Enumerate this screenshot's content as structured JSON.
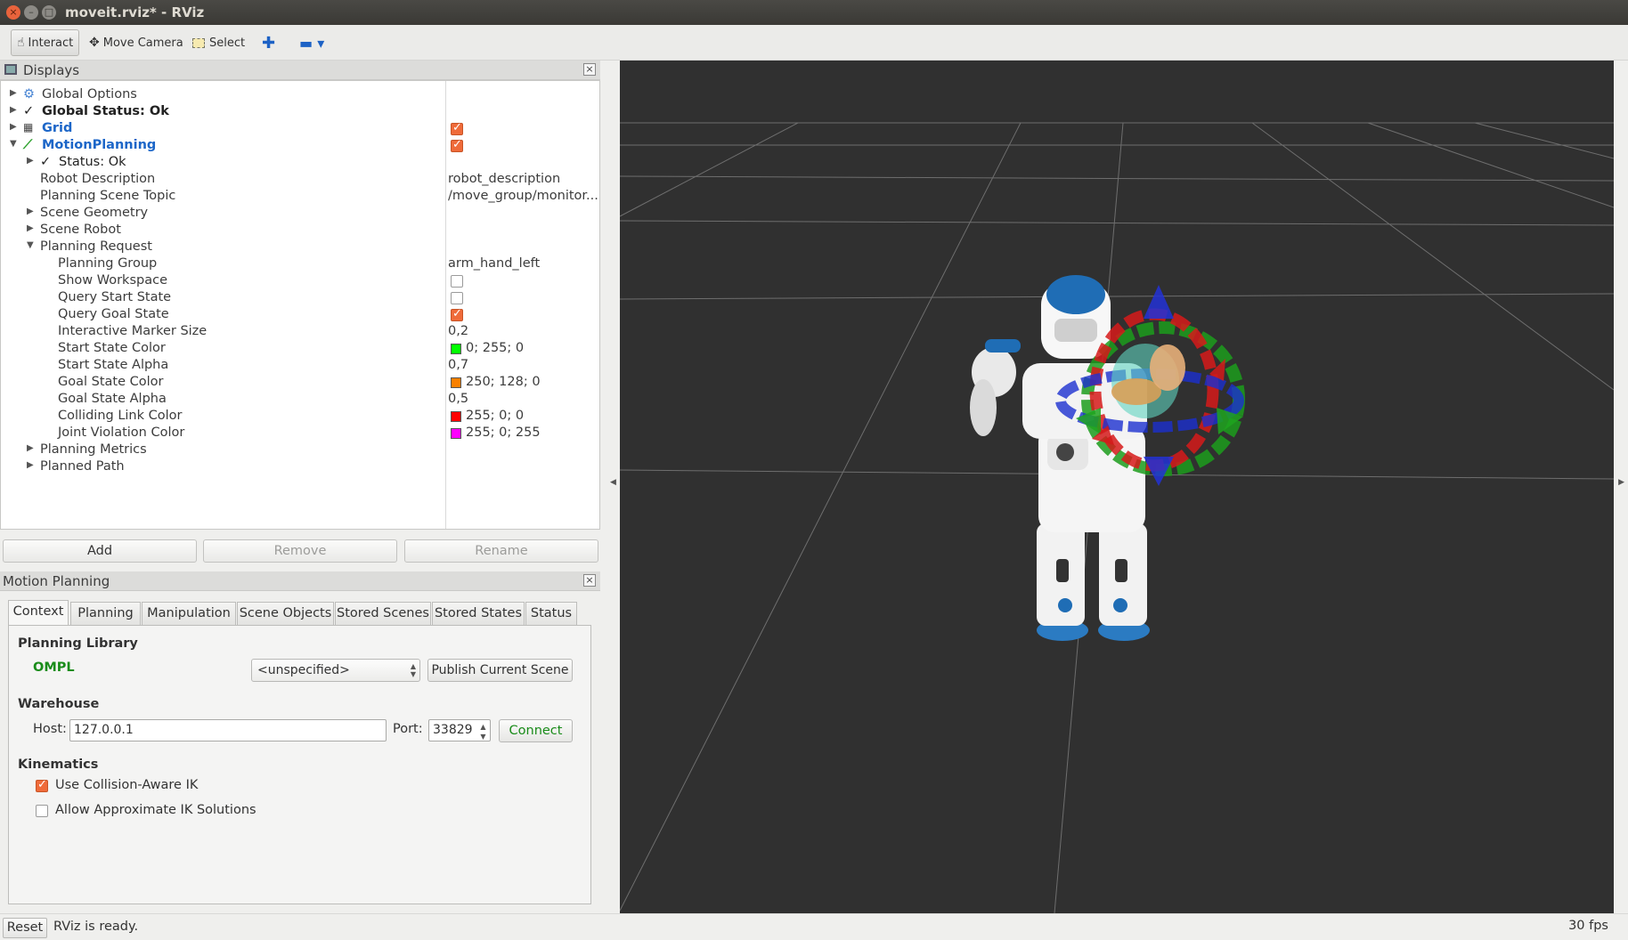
{
  "window": {
    "title": "moveit.rviz* - RViz",
    "close_glyph": "×",
    "min_glyph": "–",
    "max_glyph": "□"
  },
  "toolbar": {
    "interact": "Interact",
    "move_camera": "Move Camera",
    "select": "Select",
    "add_tool_glyph": "✚",
    "remove_tool_glyph": "▬ ▾"
  },
  "displays": {
    "title": "Displays",
    "close_glyph": "×",
    "rows": {
      "global_options": "Global Options",
      "global_status": "Global Status: Ok",
      "grid": "Grid",
      "motion_planning": "MotionPlanning",
      "status": "Status: Ok",
      "robot_description": "Robot Description",
      "robot_description_val": "robot_description",
      "planning_scene_topic": "Planning Scene Topic",
      "planning_scene_topic_val": "/move_group/monitor...",
      "scene_geometry": "Scene Geometry",
      "scene_robot": "Scene Robot",
      "planning_request": "Planning Request",
      "planning_group": "Planning Group",
      "planning_group_val": "arm_hand_left",
      "show_workspace": "Show Workspace",
      "query_start_state": "Query Start State",
      "query_goal_state": "Query Goal State",
      "interactive_marker_size": "Interactive Marker Size",
      "interactive_marker_size_val": "0,2",
      "start_state_color": "Start State Color",
      "start_state_color_val": "0; 255; 0",
      "start_state_alpha": "Start State Alpha",
      "start_state_alpha_val": "0,7",
      "goal_state_color": "Goal State Color",
      "goal_state_color_val": "250; 128; 0",
      "goal_state_alpha": "Goal State Alpha",
      "goal_state_alpha_val": "0,5",
      "colliding_link_color": "Colliding Link Color",
      "colliding_link_color_val": "255; 0; 0",
      "joint_violation_color": "Joint Violation Color",
      "joint_violation_color_val": "255; 0; 255",
      "planning_metrics": "Planning Metrics",
      "planned_path": "Planned Path"
    },
    "checks": {
      "grid": true,
      "motion_planning": true,
      "show_workspace": false,
      "query_start_state": false,
      "query_goal_state": true
    },
    "colors": {
      "start_state": "#00ff00",
      "goal_state": "#fa8000",
      "colliding_link": "#ff0000",
      "joint_violation": "#ff00ff"
    },
    "buttons": {
      "add": "Add",
      "remove": "Remove",
      "rename": "Rename"
    }
  },
  "motion_planning": {
    "title": "Motion Planning",
    "close_glyph": "×",
    "tabs": [
      "Context",
      "Planning",
      "Manipulation",
      "Scene Objects",
      "Stored Scenes",
      "Stored States",
      "Status"
    ],
    "active_tab": "Context",
    "planning_library": {
      "heading": "Planning Library",
      "library": "OMPL",
      "planner": "<unspecified>",
      "publish_button": "Publish Current Scene"
    },
    "warehouse": {
      "heading": "Warehouse",
      "host_label": "Host:",
      "host_value": "127.0.0.1",
      "port_label": "Port:",
      "port_value": "33829",
      "connect_button": "Connect"
    },
    "kinematics": {
      "heading": "Kinematics",
      "collision_aware_ik": "Use Collision-Aware IK",
      "collision_aware_ik_checked": true,
      "approx_ik": "Allow Approximate IK Solutions",
      "approx_ik_checked": false
    }
  },
  "statusbar": {
    "reset": "Reset",
    "status": "RViz is ready.",
    "fps": "30 fps"
  }
}
